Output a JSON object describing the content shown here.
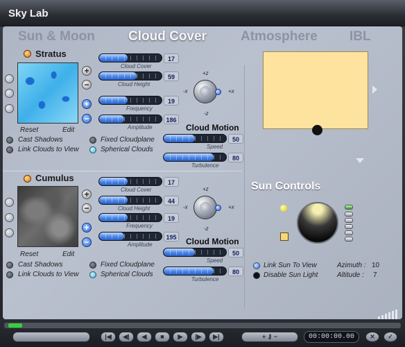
{
  "window": {
    "title": "Sky Lab"
  },
  "tabs": [
    {
      "label": "Sun & Moon",
      "active": false
    },
    {
      "label": "Cloud Cover",
      "active": true
    },
    {
      "label": "Atmosphere",
      "active": false
    },
    {
      "label": "IBL",
      "active": false
    }
  ],
  "layers": [
    {
      "name": "Stratus",
      "texture": "stratus",
      "reset": "Reset",
      "edit": "Edit",
      "sliders": [
        {
          "label": "Cloud Cover",
          "value": "17",
          "fraction": 0.45
        },
        {
          "label": "Cloud Height",
          "value": "59",
          "fraction": 0.6
        },
        {
          "label": "Frequency",
          "value": "19",
          "fraction": 0.45
        },
        {
          "label": "Amplitude",
          "value": "186",
          "fraction": 0.4
        }
      ],
      "options": [
        "Cast Shadows",
        "Link Clouds to View",
        "Fixed Cloudplane",
        "Spherical Clouds"
      ],
      "motion_title": "Cloud Motion",
      "motion": [
        {
          "label": "Speed",
          "value": "50",
          "fraction": 0.5
        },
        {
          "label": "Turbulence",
          "value": "80",
          "fraction": 0.8
        }
      ]
    },
    {
      "name": "Cumulus",
      "texture": "cumulus",
      "reset": "Reset",
      "edit": "Edit",
      "sliders": [
        {
          "label": "Cloud Cover",
          "value": "17",
          "fraction": 0.45
        },
        {
          "label": "Cloud Height",
          "value": "44",
          "fraction": 0.45
        },
        {
          "label": "Frequency",
          "value": "19",
          "fraction": 0.45
        },
        {
          "label": "Amplitude",
          "value": "195",
          "fraction": 0.4
        }
      ],
      "options": [
        "Cast Shadows",
        "Link Clouds to View",
        "Fixed Cloudplane",
        "Spherical Clouds"
      ],
      "motion_title": "Cloud Motion",
      "motion": [
        {
          "label": "Speed",
          "value": "50",
          "fraction": 0.5
        },
        {
          "label": "Turbulence",
          "value": "80",
          "fraction": 0.8
        }
      ]
    }
  ],
  "axes": {
    "top": "+z",
    "bottom": "-z",
    "left": "-x",
    "right": "+x"
  },
  "sun_controls": {
    "title": "Sun Controls",
    "link_label": "Link Sun To View",
    "disable_label": "Disable Sun Light",
    "azimuth_label": "Azimuth :",
    "azimuth_value": "10",
    "altitude_label": "Altitude :",
    "altitude_value": "7"
  },
  "transport": {
    "timecode": "00:00:00.00",
    "buttons": [
      "|◀",
      "◀|",
      "◀",
      "■",
      "▶",
      "|▶",
      "▶|"
    ]
  },
  "colors": {
    "accent": "#4a86e6",
    "sun_panel": "#fde39e",
    "active_tab": "#f4f6fa"
  }
}
